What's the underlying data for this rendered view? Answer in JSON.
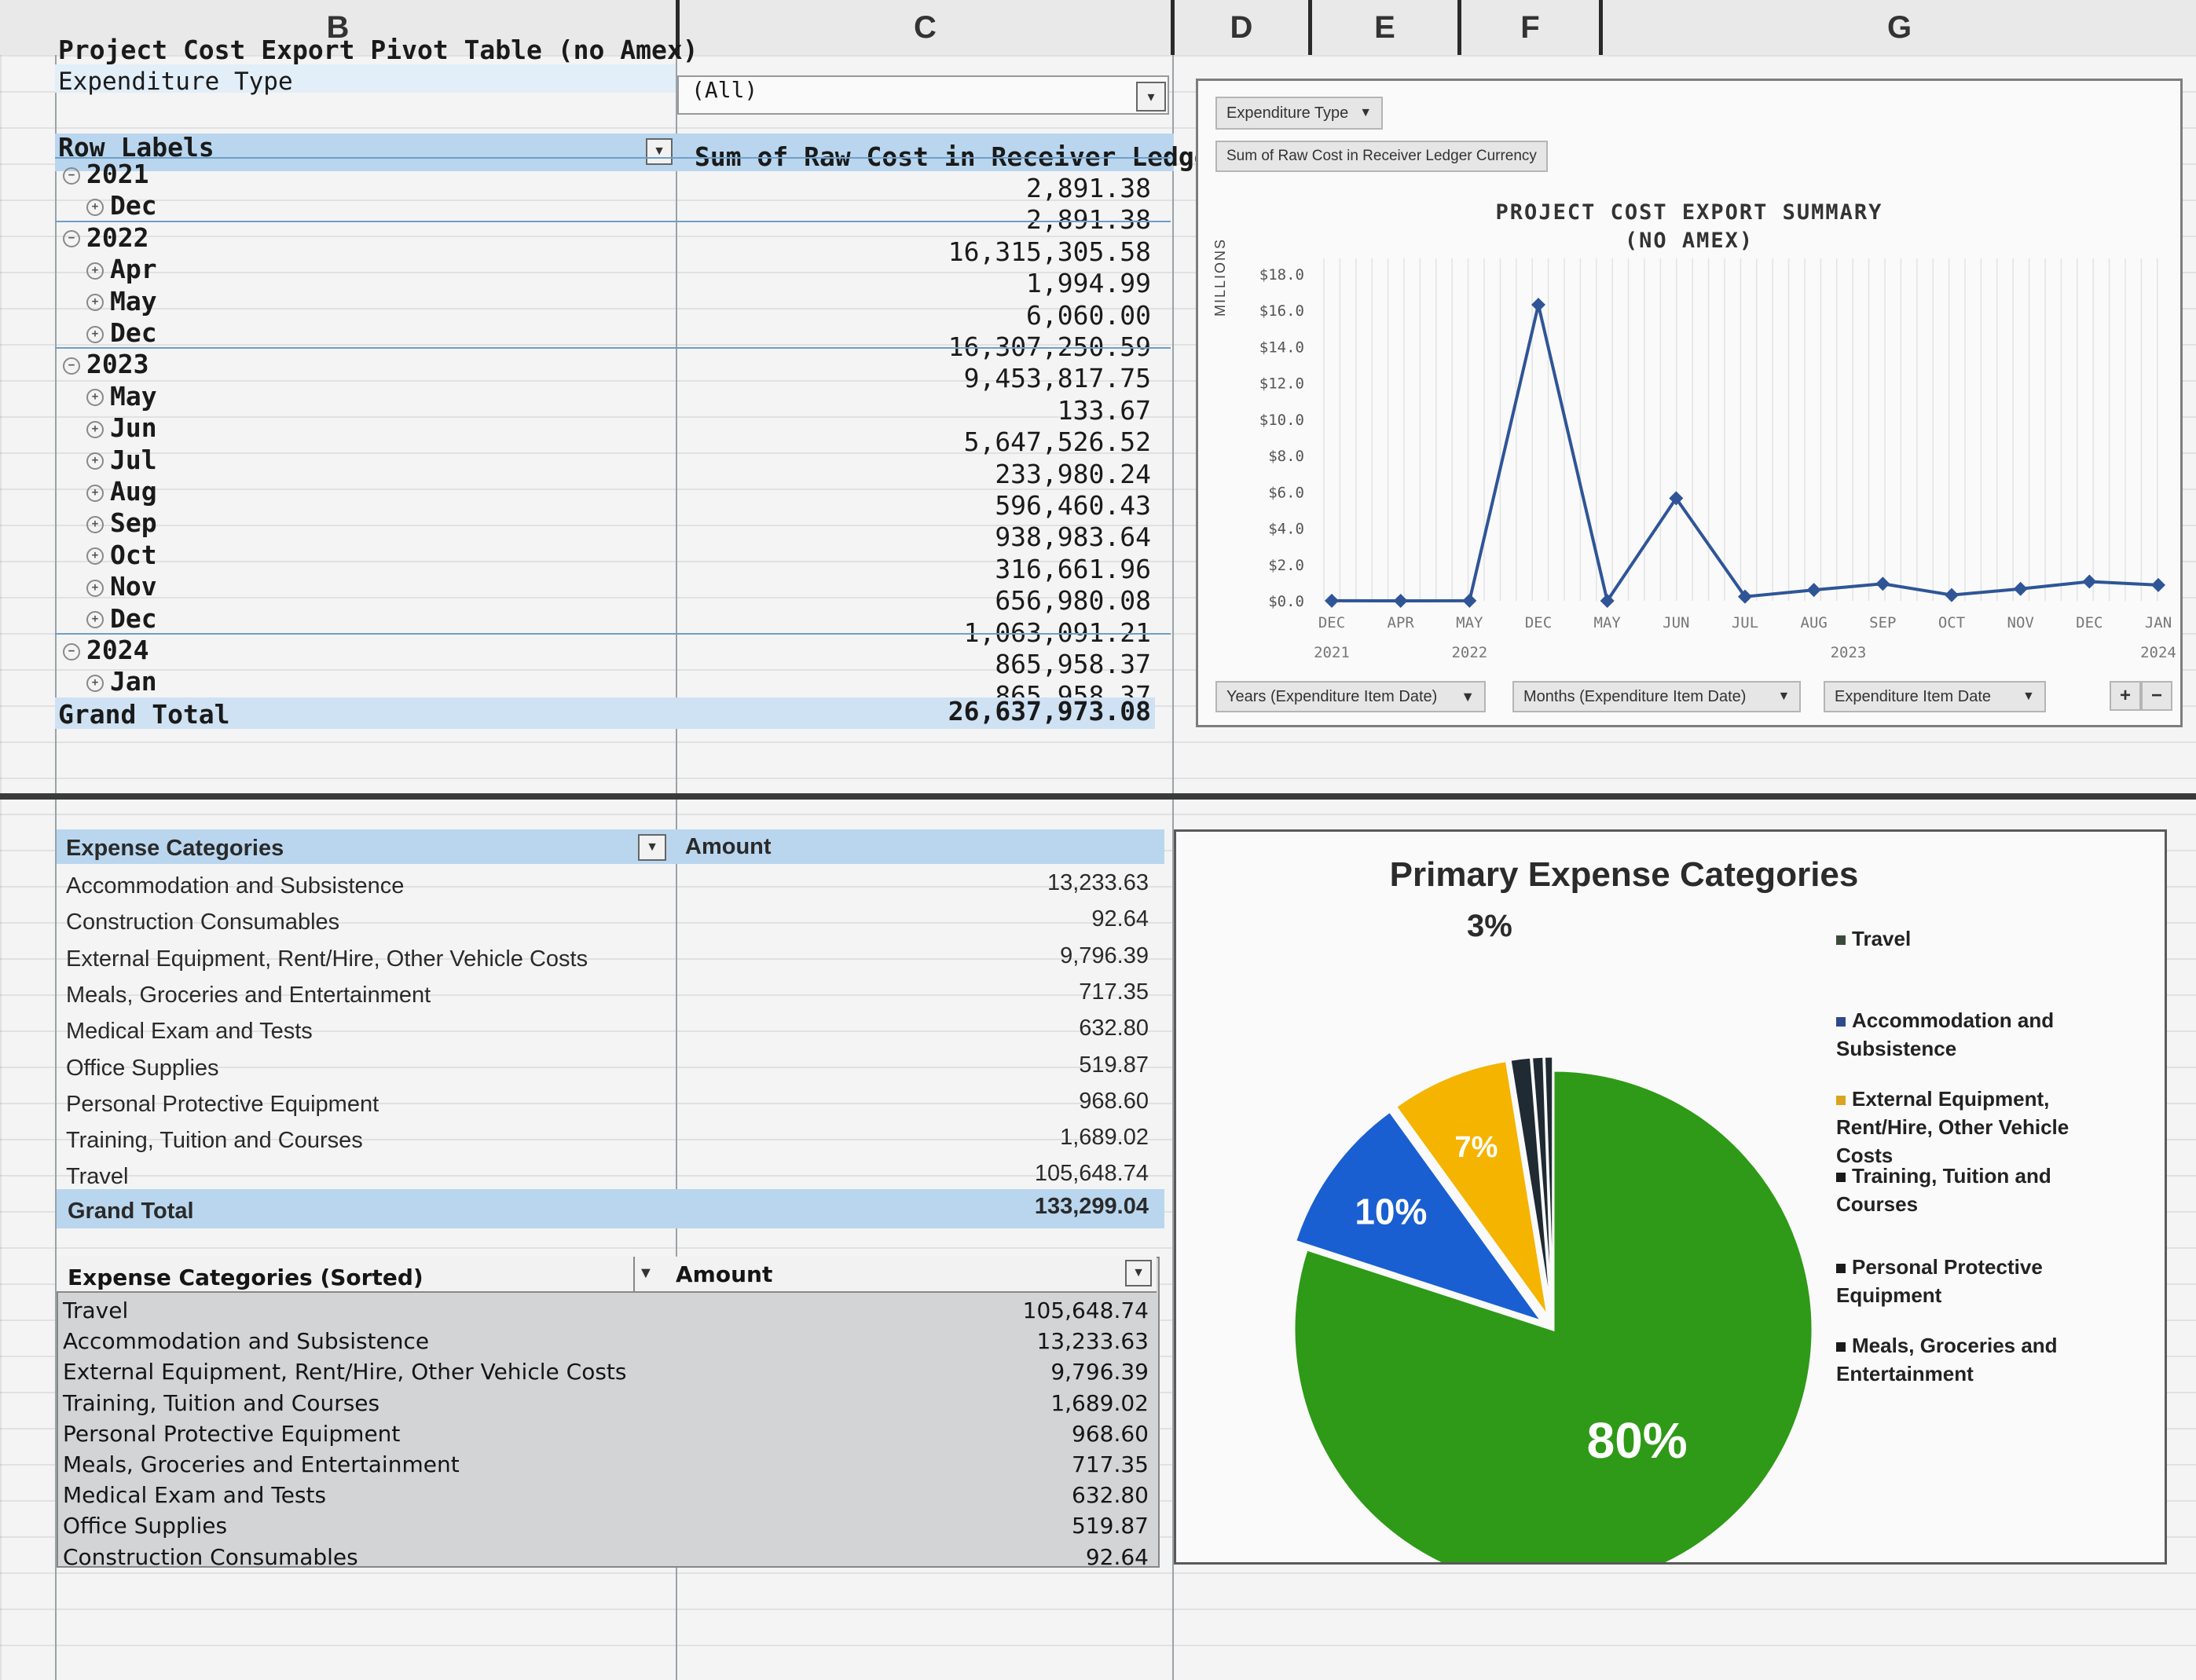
{
  "columns": [
    "B",
    "C",
    "D",
    "E",
    "F",
    "G"
  ],
  "pivot1": {
    "title": "Project Cost Export Pivot Table (no Amex)",
    "filter_label": "Expenditure Type",
    "filter_value": "(All)",
    "row_labels_header": "Row Labels",
    "value_header": "Sum of Raw Cost in Receiver Ledger C",
    "rows": [
      {
        "label": "2021",
        "value": "2,891.38",
        "level": 0
      },
      {
        "label": "Dec",
        "value": "2,891.38",
        "level": 1
      },
      {
        "label": "2022",
        "value": "16,315,305.58",
        "level": 0
      },
      {
        "label": "Apr",
        "value": "1,994.99",
        "level": 1
      },
      {
        "label": "May",
        "value": "6,060.00",
        "level": 1
      },
      {
        "label": "Dec",
        "value": "16,307,250.59",
        "level": 1
      },
      {
        "label": "2023",
        "value": "9,453,817.75",
        "level": 0
      },
      {
        "label": "May",
        "value": "133.67",
        "level": 1
      },
      {
        "label": "Jun",
        "value": "5,647,526.52",
        "level": 1
      },
      {
        "label": "Jul",
        "value": "233,980.24",
        "level": 1
      },
      {
        "label": "Aug",
        "value": "596,460.43",
        "level": 1
      },
      {
        "label": "Sep",
        "value": "938,983.64",
        "level": 1
      },
      {
        "label": "Oct",
        "value": "316,661.96",
        "level": 1
      },
      {
        "label": "Nov",
        "value": "656,980.08",
        "level": 1
      },
      {
        "label": "Dec",
        "value": "1,063,091.21",
        "level": 1
      },
      {
        "label": "2024",
        "value": "865,958.37",
        "level": 0
      },
      {
        "label": "Jan",
        "value": "865,958.37",
        "level": 1
      }
    ],
    "grand_total_label": "Grand Total",
    "grand_total_value": "26,637,973.08"
  },
  "line_chart": {
    "filter_chip": "Expenditure Type",
    "value_chip": "Sum of Raw Cost in Receiver Ledger Currency",
    "axis_unit": "MILLIONS",
    "title_line1": "PROJECT COST EXPORT SUMMARY",
    "title_line2": "(NO AMEX)",
    "field_chips": [
      "Years (Expenditure Item Date)",
      "Months (Expenditure Item Date)",
      "Expenditure Item Date"
    ],
    "zoom_controls": [
      "+",
      "−"
    ]
  },
  "chart_data": [
    {
      "type": "line",
      "title": "PROJECT COST EXPORT SUMMARY (NO AMEX)",
      "ylabel": "MILLIONS",
      "ylim": [
        0,
        18
      ],
      "yticks": [
        "$0.0",
        "$2.0",
        "$4.0",
        "$6.0",
        "$8.0",
        "$10.0",
        "$12.0",
        "$14.0",
        "$16.0",
        "$18.0"
      ],
      "categories": [
        "DEC",
        "APR",
        "MAY",
        "DEC",
        "MAY",
        "JUN",
        "JUL",
        "AUG",
        "SEP",
        "OCT",
        "NOV",
        "DEC",
        "JAN"
      ],
      "year_labels": [
        {
          "label": "2021",
          "from": 0,
          "to": 0
        },
        {
          "label": "2022",
          "from": 1,
          "to": 3
        },
        {
          "label": "2023",
          "from": 4,
          "to": 11
        },
        {
          "label": "2024",
          "from": 12,
          "to": 12
        }
      ],
      "values": [
        0.003,
        0.002,
        0.006,
        16.31,
        0.0001,
        5.65,
        0.23,
        0.6,
        0.94,
        0.32,
        0.66,
        1.06,
        0.87
      ],
      "color": "#2f5597",
      "grid": true
    },
    {
      "type": "pie",
      "title": "Primary Expense Categories",
      "labels": [
        "Travel",
        "Accommodation and Subsistence",
        "External Equipment, Rent/Hire, Other Vehicle Costs",
        "Training, Tuition and Courses",
        "Personal Protective Equipment",
        "Meals, Groceries and Entertainment"
      ],
      "values": [
        105648.74,
        13233.63,
        9796.39,
        1689.02,
        968.6,
        717.35
      ],
      "data_labels": [
        "80%",
        "10%",
        "7%",
        "",
        "",
        ""
      ],
      "outside_label": "3%",
      "colors": [
        "#2e9a17",
        "#1a5fd1",
        "#f4b400",
        "#1f2a33",
        "#1f2a33",
        "#1f2a33"
      ],
      "legend_position": "right"
    }
  ],
  "pie_legend": [
    {
      "label": "Travel",
      "color": "#3c4a3c"
    },
    {
      "label": "Accommodation and Subsistence",
      "color": "#2f4a8a"
    },
    {
      "label": "External Equipment, Rent/Hire, Other Vehicle Costs",
      "color": "#d9a520"
    },
    {
      "label": "Training, Tuition and Courses",
      "color": "#1a1a1a"
    },
    {
      "label": "Personal Protective Equipment",
      "color": "#1a1a1a"
    },
    {
      "label": "Meals, Groceries and Entertainment",
      "color": "#1a1a1a"
    }
  ],
  "table2": {
    "header_label": "Expense Categories",
    "header_value": "Amount",
    "rows": [
      {
        "label": "Accommodation and Subsistence",
        "value": "13,233.63"
      },
      {
        "label": "Construction Consumables",
        "value": "92.64"
      },
      {
        "label": "External Equipment, Rent/Hire, Other Vehicle Costs",
        "value": "9,796.39"
      },
      {
        "label": "Meals, Groceries and Entertainment",
        "value": "717.35"
      },
      {
        "label": "Medical Exam and Tests",
        "value": "632.80"
      },
      {
        "label": "Office Supplies",
        "value": "519.87"
      },
      {
        "label": "Personal Protective Equipment",
        "value": "968.60"
      },
      {
        "label": "Training, Tuition and Courses",
        "value": "1,689.02"
      },
      {
        "label": "Travel",
        "value": "105,648.74"
      }
    ],
    "grand_total_label": "Grand Total",
    "grand_total_value": "133,299.04"
  },
  "table3": {
    "header_label": "Expense Categories (Sorted)",
    "header_value": "Amount",
    "rows": [
      {
        "label": "Travel",
        "value": "105,648.74"
      },
      {
        "label": "Accommodation and Subsistence",
        "value": "13,233.63"
      },
      {
        "label": "External Equipment, Rent/Hire, Other Vehicle Costs",
        "value": "9,796.39"
      },
      {
        "label": "Training, Tuition and Courses",
        "value": "1,689.02"
      },
      {
        "label": "Personal Protective Equipment",
        "value": "968.60"
      },
      {
        "label": "Meals, Groceries and Entertainment",
        "value": "717.35"
      },
      {
        "label": "Medical Exam and Tests",
        "value": "632.80"
      },
      {
        "label": "Office Supplies",
        "value": "519.87"
      },
      {
        "label": "Construction Consumables",
        "value": "92.64"
      }
    ]
  }
}
